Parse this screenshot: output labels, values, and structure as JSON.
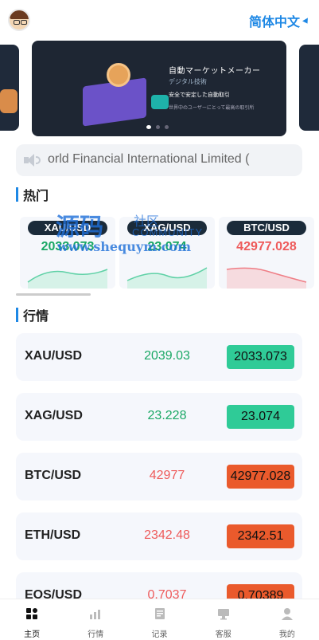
{
  "header": {
    "language_label": "简体中文"
  },
  "banner": {
    "title": "自動マーケットメーカー",
    "subtitle": "デジタル技術",
    "line1": "安全で安定した自動取引",
    "line2": "世界中のユーザーにとって最高の取引所"
  },
  "notice": {
    "text": "orld Financial International Limited ("
  },
  "hot": {
    "title": "热门",
    "items": [
      {
        "symbol": "XAU/USD",
        "price": "2033.073",
        "color": "#1aa865"
      },
      {
        "symbol": "XAG/USD",
        "price": "23.074",
        "color": "#1aa865"
      },
      {
        "symbol": "BTC/USD",
        "price": "42977.028",
        "color": "#ee5a5a"
      }
    ]
  },
  "watermark": {
    "chars": "源码",
    "suffix": "社区",
    "english": "COMMUNITY",
    "url": "www.shequym.com"
  },
  "market": {
    "title": "行情",
    "rows": [
      {
        "symbol": "XAU/USD",
        "last": "2039.03",
        "price": "2033.073",
        "trend": "up",
        "last_color": "#1aa865",
        "badge_color": "#2fcb97"
      },
      {
        "symbol": "XAG/USD",
        "last": "23.228",
        "price": "23.074",
        "trend": "up",
        "last_color": "#1aa865",
        "badge_color": "#2fcb97"
      },
      {
        "symbol": "BTC/USD",
        "last": "42977",
        "price": "42977.028",
        "trend": "down",
        "last_color": "#ee5a5a",
        "badge_color": "#ea5a2c"
      },
      {
        "symbol": "ETH/USD",
        "last": "2342.48",
        "price": "2342.51",
        "trend": "down",
        "last_color": "#ee5a5a",
        "badge_color": "#ea5a2c"
      },
      {
        "symbol": "EOS/USD",
        "last": "0.7037",
        "price": "0.70389",
        "trend": "down",
        "last_color": "#ee5a5a",
        "badge_color": "#ea5a2c"
      }
    ]
  },
  "tabs": [
    {
      "label": "主页",
      "icon": "home-grid-icon",
      "active": true
    },
    {
      "label": "行情",
      "icon": "chart-icon",
      "active": false
    },
    {
      "label": "记录",
      "icon": "record-icon",
      "active": false
    },
    {
      "label": "客服",
      "icon": "service-icon",
      "active": false
    },
    {
      "label": "我的",
      "icon": "user-icon",
      "active": false
    }
  ]
}
